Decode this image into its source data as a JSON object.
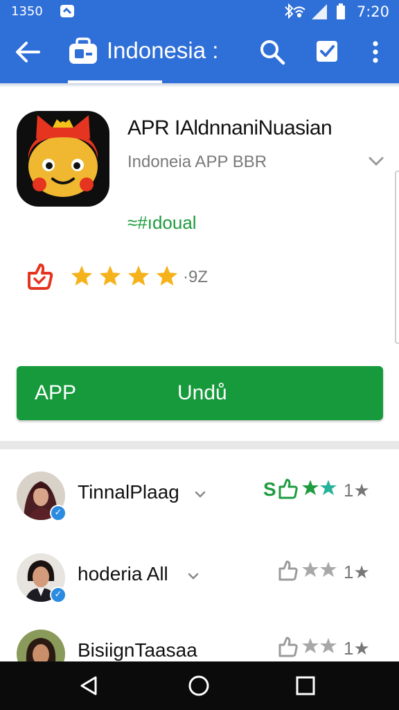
{
  "status_bar": {
    "time_left": "1350",
    "clock": "7:20"
  },
  "toolbar": {
    "title": "Indonesia :",
    "icons": [
      "back-arrow-icon",
      "store-bag-icon",
      "search-icon",
      "checkbox-icon",
      "more-vert-icon"
    ]
  },
  "app": {
    "name": "APR IAldnnaniNuasian",
    "developer": "Indoneia APP BBR",
    "tag": "≈#ıdoual",
    "rating_count": "·9Z",
    "stars": 4
  },
  "install_bar": {
    "left_label": "APP",
    "main_label": "Undů"
  },
  "reviews": [
    {
      "name": "TinnalPlaag",
      "score_label": "1★",
      "money_label": "S",
      "avatar": "avatar-woman-hijab"
    },
    {
      "name": "hoderia All",
      "score_label": "1★",
      "avatar": "avatar-woman-suit"
    },
    {
      "name": "BisiignTaasaa",
      "score_label": "1★",
      "avatar": "avatar-woman-outdoor"
    }
  ],
  "colors": {
    "primary_blue": "#2f6fd8",
    "install_green": "#169a3c",
    "star_yellow": "#f5b21b",
    "review_green": "#1e9c3f",
    "teal_star": "#27b39b"
  },
  "nav_bar": {
    "buttons": [
      "back-triangle-icon",
      "home-circle-icon",
      "recents-square-icon"
    ]
  }
}
